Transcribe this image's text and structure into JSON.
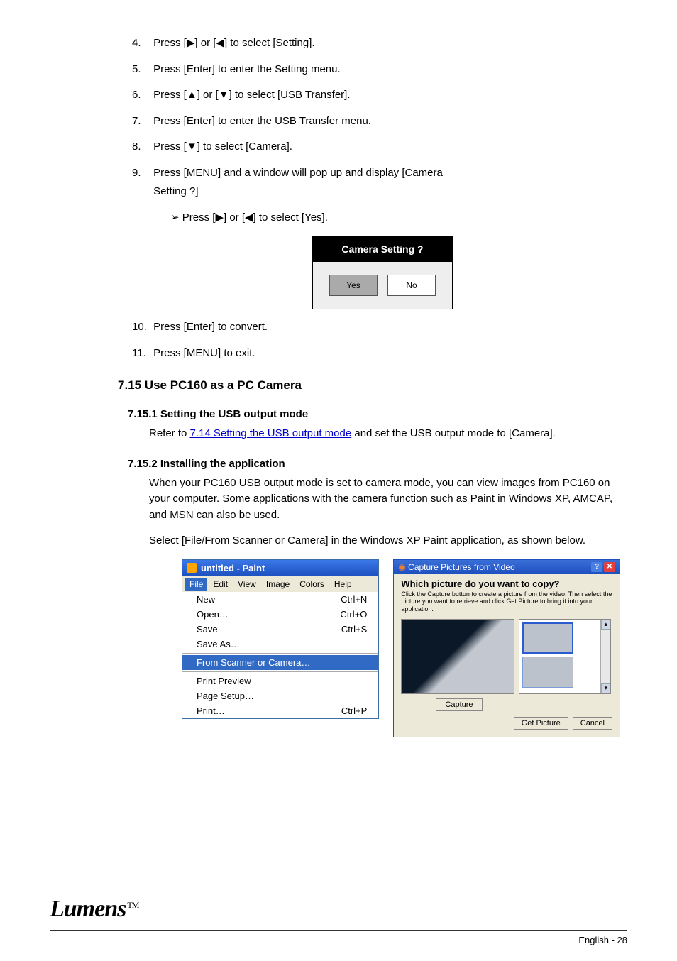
{
  "section_7_14": {
    "item4": {
      "num": "4.",
      "pre": "Press [",
      "a1": "▶",
      "mid": "] or [",
      "a2": "◀",
      "post": "] to select [Setting]."
    },
    "item5": {
      "num": "5.",
      "text": "Press [Enter] to enter the Setting menu."
    },
    "item6": {
      "num": "6.",
      "pre": "Press [",
      "a1": "▲",
      "mid": "] or [",
      "a2": "▼",
      "post": "] to select [USB Transfer]."
    },
    "item7": {
      "num": "7.",
      "text": "Press [Enter] to enter the USB Transfer menu."
    },
    "item8": {
      "num": "8.",
      "pre": "Press [",
      "a1": "▼",
      "post": "] to select [Camera]."
    },
    "item9": {
      "num": "9.",
      "l1": "Press [MENU] and a window will pop up and display [Camera",
      "l2": "Setting ?]",
      "sub": {
        "icon": "➢",
        "pre": " Press [",
        "a1": "▶",
        "mid": "] or [",
        "a2": "◀",
        "post": "] to select [Yes]."
      }
    },
    "dialog": {
      "title": "Camera Setting ?",
      "yes": "Yes",
      "no": "No"
    },
    "item10": {
      "num": "10.",
      "text": "Press [Enter] to convert."
    },
    "item11": {
      "num": "11.",
      "text": "Press [MENU] to exit."
    },
    "heading": "7.15 Use PC160 as a PC Camera",
    "sub1": {
      "title": "7.15.1 Setting the USB output mode",
      "text_pre": "Refer to ",
      "link_text": "7.14 Setting the USB output mode",
      "text_post": " and set the USB output mode to [Camera]."
    },
    "sub2": {
      "title": "7.15.2 Installing the application",
      "p1": "When your PC160 USB output mode is set to camera mode, you can view images from PC160 on your computer. Some applications with the camera function such as Paint in Windows XP, AMCAP, and MSN can also be used.",
      "p2": "Select [File/From Scanner or Camera] in the Windows XP Paint application, as shown below."
    }
  },
  "paint": {
    "title": "untitled - Paint",
    "menubar": [
      "File",
      "Edit",
      "View",
      "Image",
      "Colors",
      "Help"
    ],
    "items": [
      {
        "label": "New",
        "shortcut": "Ctrl+N"
      },
      {
        "label": "Open…",
        "shortcut": "Ctrl+O"
      },
      {
        "label": "Save",
        "shortcut": "Ctrl+S"
      },
      {
        "label": "Save As…",
        "shortcut": ""
      },
      {
        "label": "From Scanner or Camera…",
        "shortcut": "",
        "highlight": true
      },
      {
        "label": "Print Preview",
        "shortcut": ""
      },
      {
        "label": "Page Setup…",
        "shortcut": ""
      },
      {
        "label": "Print…",
        "shortcut": "Ctrl+P"
      }
    ]
  },
  "capture": {
    "title": "Capture Pictures from Video",
    "question": "Which picture do you want to copy?",
    "sub": "Click the Capture button to create a picture from the video. Then select the picture you want to retrieve and click Get Picture to bring it into your application.",
    "capture_btn": "Capture",
    "get_btn": "Get Picture",
    "cancel_btn": "Cancel"
  },
  "footer": {
    "brand": "Lumens",
    "tm": "TM",
    "page_en": "English -",
    "page_num": "28"
  }
}
